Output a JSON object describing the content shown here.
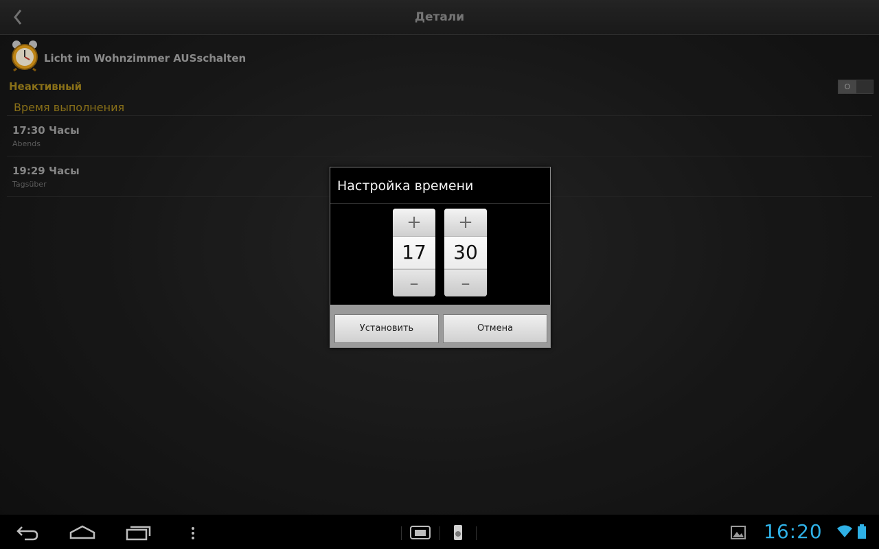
{
  "actionbar": {
    "title": "Детали"
  },
  "task": {
    "title": "Licht im Wohnzimmer AUSschalten",
    "icon": "alarm-clock-icon"
  },
  "status": {
    "label": "Неактивный",
    "toggle_text": "O",
    "active": false
  },
  "section": {
    "header": "Время выполнения"
  },
  "times": [
    {
      "main": "17:30 Часы",
      "sub": "Abends"
    },
    {
      "main": "19:29 Часы",
      "sub": "Tagsüber"
    }
  ],
  "dialog": {
    "title": "Настройка времени",
    "hour": "17",
    "minute": "30",
    "increment_symbol": "+",
    "decrement_symbol": "–",
    "set_label": "Установить",
    "cancel_label": "Отмена"
  },
  "statusbar": {
    "clock": "16:20"
  },
  "colors": {
    "accent": "#a8891e",
    "clock": "#2fb1e6"
  }
}
